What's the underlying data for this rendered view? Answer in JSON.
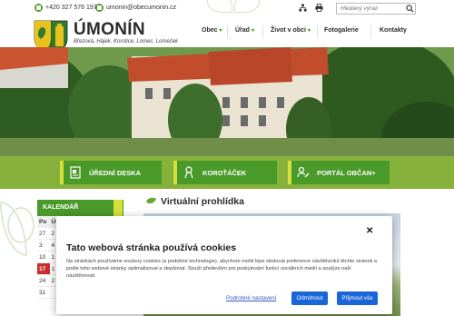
{
  "topbar": {
    "phone": "+420 327 576 197",
    "email": "umonin@obecumonin.cz",
    "search_placeholder": "Hledaný výraz"
  },
  "brand": {
    "title": "ÚMONÍN",
    "subtitle": "Březová, Hájek, Korotice, Lomec, Lomeček"
  },
  "nav": {
    "items": [
      {
        "label": "Obec",
        "has_submenu": true
      },
      {
        "label": "Úřad",
        "has_submenu": true
      },
      {
        "label": "Život v obci",
        "has_submenu": true
      },
      {
        "label": "Fotogalerie",
        "has_submenu": false
      },
      {
        "label": "Kontakty",
        "has_submenu": false
      }
    ]
  },
  "quicklinks": [
    {
      "label": "ÚŘEDNÍ DESKA",
      "icon": "notice-board-icon"
    },
    {
      "label": "KOROŤÁČEK",
      "icon": "mascot-icon"
    },
    {
      "label": "PORTÁL OBČAN+",
      "icon": "citizen-edit-icon"
    }
  ],
  "calendar": {
    "title": "KALENDÁŘ",
    "weekdays": [
      "Po",
      "Út",
      "",
      "",
      "",
      "",
      ""
    ],
    "rows": [
      [
        "27",
        "2",
        "",
        "",
        "",
        "",
        ""
      ],
      [
        "3",
        "4",
        "",
        "",
        "",
        "",
        ""
      ],
      [
        "10",
        "1",
        "",
        "",
        "",
        "",
        ""
      ],
      [
        "17",
        "1",
        "",
        "",
        "",
        "",
        ""
      ],
      [
        "24",
        "2",
        "",
        "",
        "",
        "",
        ""
      ],
      [
        "31",
        "",
        "",
        "",
        "",
        "",
        ""
      ]
    ],
    "today": "17"
  },
  "main": {
    "section_title": "Virtuální prohlídka"
  },
  "cookie": {
    "title": "Tato webová stránka používá cookies",
    "text": "Na stránkách používáme soubory cookies (a podobné technologie), abychom mohli lépe sledovat preference návštěvníků těchto stránek a podle toho webové stránky optimalizovat a zlepšovat. Slouží především pro poskytování funkcí sociálních médií a analýze naší návštěvnosti.",
    "settings_label": "Podrobné nastavení",
    "reject_label": "Odmítnout",
    "accept_label": "Přijmout vše",
    "close_glyph": "✕"
  },
  "colors": {
    "brand_green": "#4a9a2a",
    "band_green": "#86b23c",
    "accent_yellow": "#d6e03a",
    "button_blue": "#1a66d9",
    "today_red": "#c8302e"
  }
}
